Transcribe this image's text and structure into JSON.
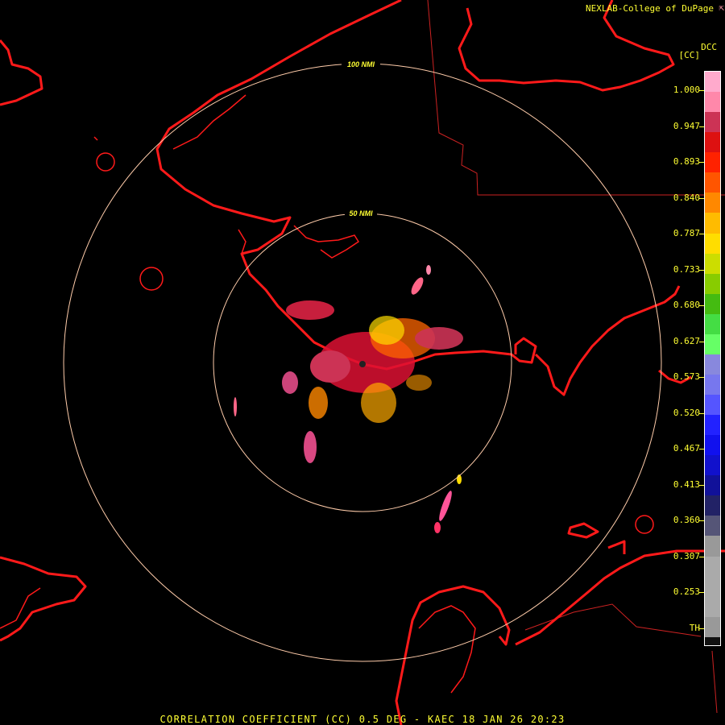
{
  "credit": "NEXLAB-College of DuPage",
  "credit_icon": "external-link-icon",
  "product_code": "DCC",
  "unit_label": "[CC]",
  "caption": "CORRELATION COEFFICIENT (CC) 0.5 DEG - KAEC 18 JAN 26 20:23",
  "range_rings": [
    {
      "label": "50 NMI"
    },
    {
      "label": "100 NMI"
    }
  ],
  "colors": {
    "coastline": "#ff1a1a",
    "state_line": "#cc2222",
    "range_ring": "#ffccaa",
    "text": "#ffff33"
  },
  "legend": {
    "ticks": [
      "1.000",
      "0.947",
      "0.893",
      "0.840",
      "0.787",
      "0.733",
      "0.680",
      "0.627",
      "0.573",
      "0.520",
      "0.467",
      "0.413",
      "0.360",
      "0.307",
      "0.253",
      "TH"
    ],
    "color_stops": [
      "#ffaacc",
      "#ff88aa",
      "#cc3355",
      "#dd1111",
      "#ff2200",
      "#ff5500",
      "#ff8800",
      "#ffbb00",
      "#ffdd00",
      "#ccdd00",
      "#88cc00",
      "#44bb11",
      "#44dd44",
      "#66ff66",
      "#8888dd",
      "#7777ee",
      "#5555ff",
      "#2222ff",
      "#1111ee",
      "#1111cc",
      "#111199",
      "#222266",
      "#555577",
      "#999999",
      "#aaaaaa",
      "#aaaaaa",
      "#aaaaaa",
      "#999999",
      "#111111"
    ]
  }
}
